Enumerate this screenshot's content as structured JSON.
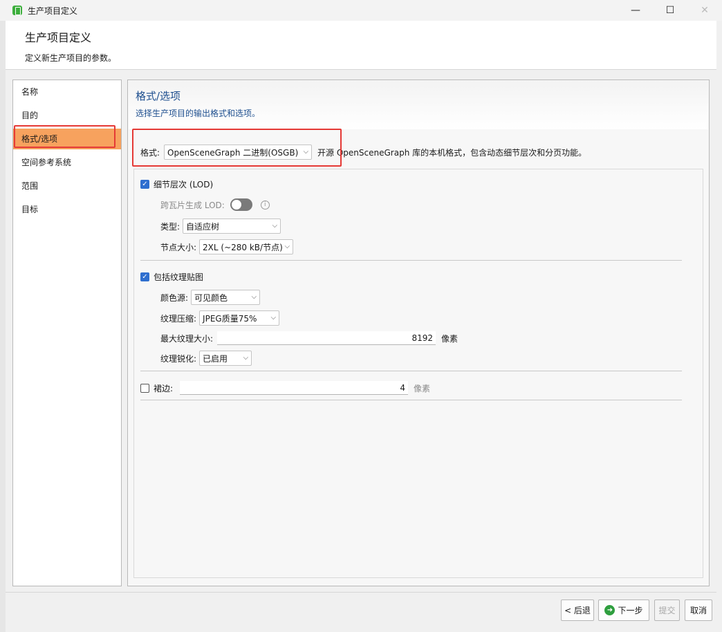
{
  "window": {
    "title": "生产项目定义",
    "minimize": "—",
    "maximize": "☐",
    "close": "✕"
  },
  "header": {
    "title": "生产项目定义",
    "description": "定义新生产项目的参数。"
  },
  "nav": {
    "items": [
      "名称",
      "目的",
      "格式/选项",
      "空间参考系统",
      "范围",
      "目标"
    ],
    "active_index": 2
  },
  "panel": {
    "title": "格式/选项",
    "description": "选择生产项目的输出格式和选项。",
    "format_label": "格式:",
    "format_value": "OpenSceneGraph 二进制(OSGB)",
    "format_note": "开源 OpenSceneGraph 库的本机格式，包含动态细节层次和分页功能。"
  },
  "lod": {
    "label": "细节层次 (LOD)",
    "checked": true,
    "cross_tile_label": "跨瓦片生成 LOD:",
    "cross_tile_enabled": false,
    "type_label": "类型:",
    "type_value": "自适应树",
    "node_size_label": "节点大小:",
    "node_size_value": "2XL (~280 kB/节点)"
  },
  "texture": {
    "label": "包括纹理贴图",
    "checked": true,
    "color_source_label": "颜色源:",
    "color_source_value": "可见颜色",
    "compression_label": "纹理压缩:",
    "compression_value": "JPEG质量75%",
    "max_size_label": "最大纹理大小:",
    "max_size_value": "8192",
    "max_size_unit": "像素",
    "sharpen_label": "纹理锐化:",
    "sharpen_value": "已启用"
  },
  "skirt": {
    "label": "裙边:",
    "checked": false,
    "value": "4",
    "unit": "像素"
  },
  "footer": {
    "back": "< 后退",
    "next": "下一步",
    "submit": "提交",
    "cancel": "取消"
  },
  "colors": {
    "accent": "#2f6fcf",
    "active_nav": "#f7a25e",
    "highlight": "#e53935"
  }
}
